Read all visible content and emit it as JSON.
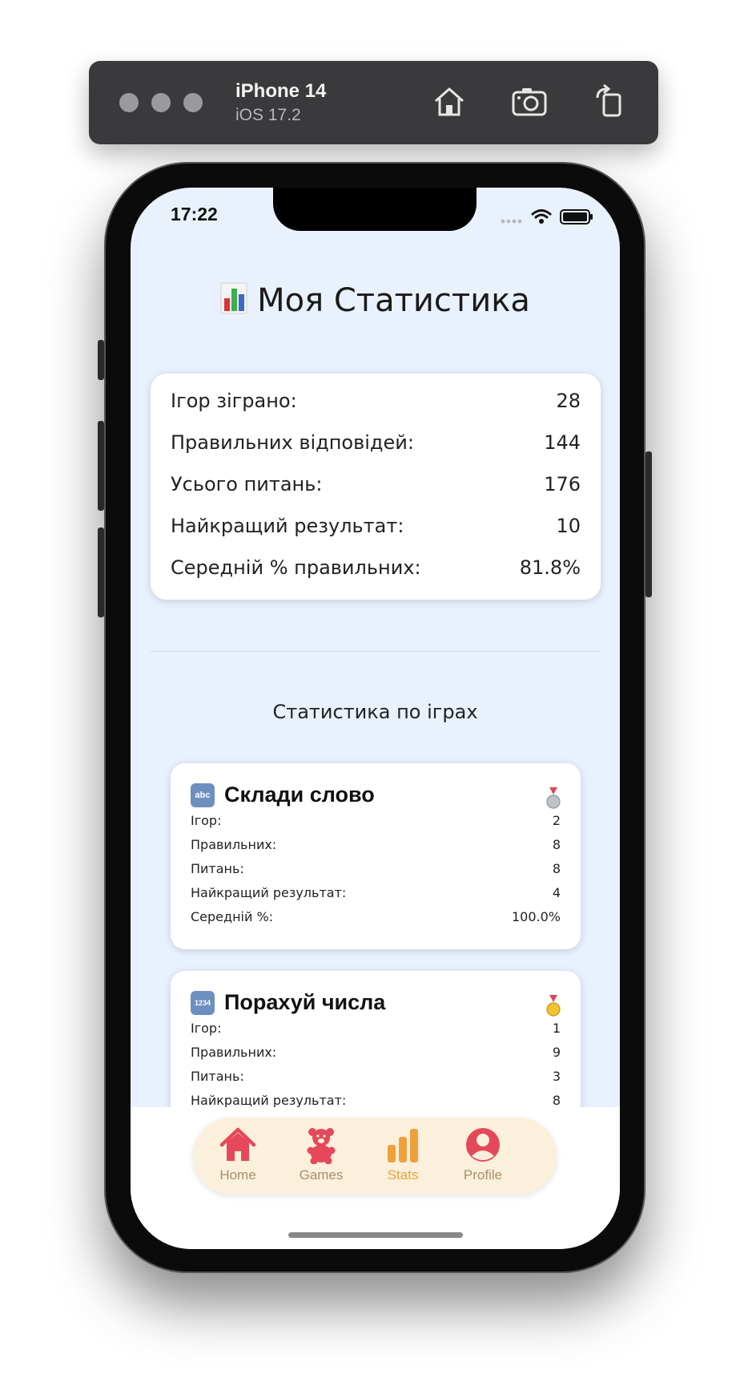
{
  "simulator": {
    "device": "iPhone 14",
    "os": "iOS 17.2",
    "buttons": [
      "home-icon",
      "screenshot-icon",
      "rotate-icon"
    ]
  },
  "status_bar": {
    "time": "17:22"
  },
  "page": {
    "title": "Моя Статистика",
    "title_emoji": "bar-chart-emoji"
  },
  "summary": {
    "rows": [
      {
        "label": "Ігор зіграно:",
        "value": "28"
      },
      {
        "label": "Правильних відповідей:",
        "value": "144"
      },
      {
        "label": "Усього питань:",
        "value": "176"
      },
      {
        "label": "Найкращий результат:",
        "value": "10"
      },
      {
        "label": "Середній % правильних:",
        "value": "81.8%"
      }
    ]
  },
  "games_section": {
    "title": "Статистика по іграх",
    "games": [
      {
        "emoji": "abc-emoji",
        "emoji_text": "abc",
        "name": "Склади слово",
        "medal": "silver-medal-icon",
        "rows": [
          {
            "label": "Ігор:",
            "value": "2"
          },
          {
            "label": "Правильних:",
            "value": "8"
          },
          {
            "label": "Питань:",
            "value": "8"
          },
          {
            "label": "Найкращий результат:",
            "value": "4"
          },
          {
            "label": "Середній %:",
            "value": "100.0%"
          }
        ]
      },
      {
        "emoji": "numbers-emoji",
        "emoji_text": "1234",
        "name": "Порахуй числа",
        "medal": "gold-medal-icon",
        "rows": [
          {
            "label": "Ігор:",
            "value": "1"
          },
          {
            "label": "Правильних:",
            "value": "9"
          },
          {
            "label": "Питань:",
            "value": "3"
          },
          {
            "label": "Найкращий результат:",
            "value": "8"
          }
        ]
      }
    ]
  },
  "tabbar": {
    "active": "Stats",
    "items": [
      {
        "label": "Home",
        "icon": "home-icon"
      },
      {
        "label": "Games",
        "icon": "teddy-bear-icon"
      },
      {
        "label": "Stats",
        "icon": "bar-chart-icon"
      },
      {
        "label": "Profile",
        "icon": "profile-icon"
      }
    ],
    "colors": {
      "inactive_icon": "#e5485a",
      "inactive_label": "#a88e6c",
      "active": "#f0a03a",
      "background": "#fbf0dc"
    }
  }
}
